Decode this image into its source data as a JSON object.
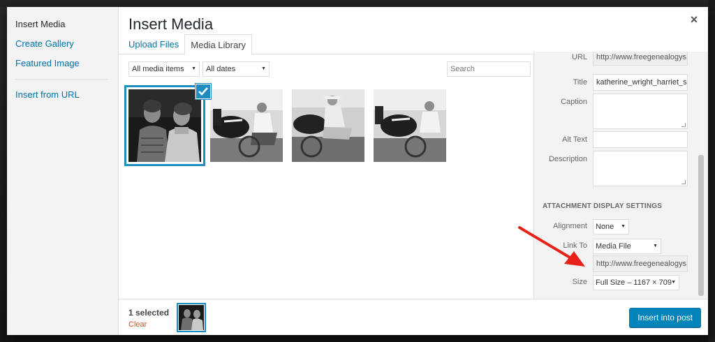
{
  "menu": {
    "items": [
      {
        "label": "Insert Media",
        "active": true
      },
      {
        "label": "Create Gallery"
      },
      {
        "label": "Featured Image"
      }
    ],
    "insert_from_url": "Insert from URL"
  },
  "frame": {
    "title": "Insert Media",
    "close": "×"
  },
  "tabs": [
    {
      "label": "Upload Files"
    },
    {
      "label": "Media Library",
      "active": true
    }
  ],
  "toolbar": {
    "filter_type": "All media items",
    "filter_date": "All dates",
    "search_placeholder": "Search"
  },
  "attachment": {
    "url_label": "URL",
    "url_value": "http://www.freegenealogys",
    "title_label": "Title",
    "title_value": "katherine_wright_harriet_s",
    "caption_label": "Caption",
    "alt_label": "Alt Text",
    "description_label": "Description"
  },
  "display_settings": {
    "heading": "ATTACHMENT DISPLAY SETTINGS",
    "alignment_label": "Alignment",
    "alignment_value": "None",
    "link_label": "Link To",
    "link_value": "Media File",
    "link_url": "http://www.freegenealogys",
    "size_label": "Size",
    "size_value": "Full Size – 1167 × 709"
  },
  "bottom": {
    "selected_count": "1 selected",
    "clear_label": "Clear",
    "insert_label": "Insert into post"
  },
  "colors": {
    "accent": "#1e8cbe",
    "primary_button": "#0085ba",
    "link": "#0073aa",
    "annotation_arrow": "#e8221b"
  }
}
